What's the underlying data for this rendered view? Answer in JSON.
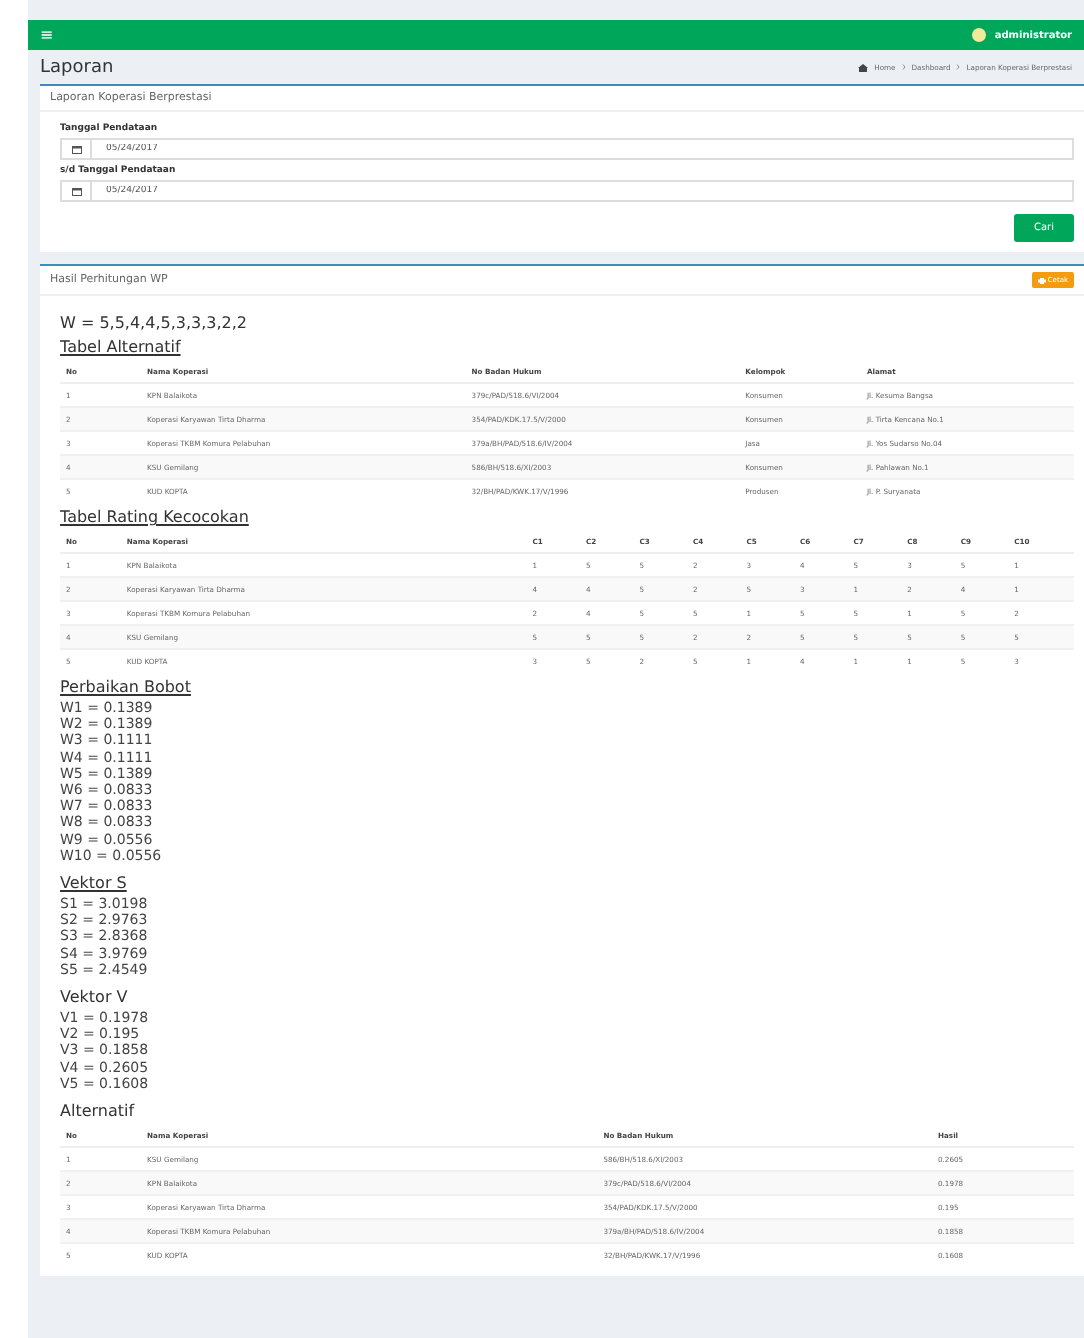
{
  "header": {
    "menu_icon": "≡",
    "user": "administrator"
  },
  "page_title": "Laporan",
  "breadcrumb": [
    "Home",
    "Dashboard",
    "Laporan Koperasi Berprestasi"
  ],
  "filter_box": {
    "title": "Laporan Koperasi Berprestasi",
    "fields": [
      {
        "label": "Tanggal Pendataan",
        "value": "05/24/2017"
      },
      {
        "label": "s/d Tanggal Pendataan",
        "value": "05/24/2017"
      }
    ],
    "button": "Cari"
  },
  "result_box": {
    "title": "Hasil Perhitungan WP",
    "print_button": "Cetak",
    "weights": "W = 5,5,4,4,5,3,3,3,2,2",
    "alt_title": "Tabel Alternatif",
    "alt_table": {
      "columns": [
        "No",
        "Nama Koperasi",
        "No Badan Hukum",
        "Kelompok",
        "Alamat"
      ],
      "rows": [
        [
          "1",
          "KPN Balaikota",
          "379c/PAD/518.6/VI/2004",
          "Konsumen",
          "Jl. Kesuma Bangsa"
        ],
        [
          "2",
          "Koperasi Karyawan Tirta Dharma",
          "354/PAD/KDK.17.5/V/2000",
          "Konsumen",
          "Jl. Tirta Kencana No.1"
        ],
        [
          "3",
          "Koperasi TKBM Komura Pelabuhan",
          "379a/BH/PAD/518.6/IV/2004",
          "Jasa",
          "Jl. Yos Sudarso No.04"
        ],
        [
          "4",
          "KSU Gemilang",
          "586/BH/518.6/XI/2003",
          "Konsumen",
          "Jl. Pahlawan No.1"
        ],
        [
          "5",
          "KUD KOPTA",
          "32/BH/PAD/KWK.17/V/1996",
          "Produsen",
          "Jl. P. Suryanata"
        ]
      ]
    },
    "rating_title": "Tabel Rating Kecocokan",
    "rating_table": {
      "columns": [
        "No",
        "Nama Koperasi",
        "C1",
        "C2",
        "C3",
        "C4",
        "C5",
        "C6",
        "C7",
        "C8",
        "C9",
        "C10"
      ],
      "rows": [
        [
          "1",
          "KPN Balaikota",
          "1",
          "5",
          "5",
          "2",
          "3",
          "4",
          "5",
          "3",
          "5",
          "1"
        ],
        [
          "2",
          "Koperasi Karyawan Tirta Dharma",
          "4",
          "4",
          "5",
          "2",
          "5",
          "3",
          "1",
          "2",
          "4",
          "1"
        ],
        [
          "3",
          "Koperasi TKBM Komura Pelabuhan",
          "2",
          "4",
          "5",
          "5",
          "1",
          "5",
          "5",
          "1",
          "5",
          "2"
        ],
        [
          "4",
          "KSU Gemilang",
          "5",
          "5",
          "5",
          "2",
          "2",
          "5",
          "5",
          "5",
          "5",
          "5"
        ],
        [
          "5",
          "KUD KOPTA",
          "3",
          "5",
          "2",
          "5",
          "1",
          "4",
          "1",
          "1",
          "5",
          "3"
        ]
      ]
    },
    "bobot_title": "Perbaikan Bobot",
    "bobot": [
      "W1 = 0.1389",
      "W2 = 0.1389",
      "W3 = 0.1111",
      "W4 = 0.1111",
      "W5 = 0.1389",
      "W6 = 0.0833",
      "W7 = 0.0833",
      "W8 = 0.0833",
      "W9 = 0.0556",
      "W10 = 0.0556"
    ],
    "s_title": "Vektor S",
    "s_values": [
      "S1 = 3.0198",
      "S2 = 2.9763",
      "S3 = 2.8368",
      "S4 = 3.9769",
      "S5 = 2.4549"
    ],
    "v_title": "Vektor V",
    "v_values": [
      "V1 = 0.1978",
      "V2 = 0.195",
      "V3 = 0.1858",
      "V4 = 0.2605",
      "V5 = 0.1608"
    ],
    "rank_title": "Alternatif",
    "rank_table": {
      "columns": [
        "No",
        "Nama Koperasi",
        "No Badan Hukum",
        "Hasil"
      ],
      "rows": [
        [
          "1",
          "KSU Gemilang",
          "586/BH/518.6/XI/2003",
          "0.2605"
        ],
        [
          "2",
          "KPN Balaikota",
          "379c/PAD/518.6/VI/2004",
          "0.1978"
        ],
        [
          "3",
          "Koperasi Karyawan Tirta Dharma",
          "354/PAD/KDK.17.5/V/2000",
          "0.195"
        ],
        [
          "4",
          "Koperasi TKBM Komura Pelabuhan",
          "379a/BH/PAD/518.6/IV/2004",
          "0.1858"
        ],
        [
          "5",
          "KUD KOPTA",
          "32/BH/PAD/KWK.17/V/1996",
          "0.1608"
        ]
      ]
    }
  }
}
